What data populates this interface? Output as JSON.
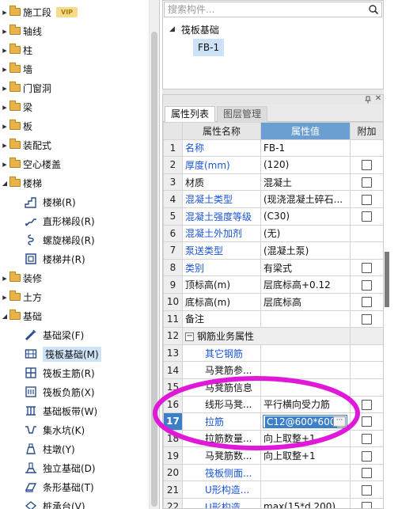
{
  "tree": {
    "top_item": {
      "label": "施工段",
      "badge": "VIP"
    },
    "folders": [
      {
        "label": "轴线",
        "collapsed": true
      },
      {
        "label": "柱",
        "collapsed": true
      },
      {
        "label": "墙",
        "collapsed": true
      },
      {
        "label": "门窗洞",
        "collapsed": true
      },
      {
        "label": "梁",
        "collapsed": true
      },
      {
        "label": "板",
        "collapsed": true
      },
      {
        "label": "装配式",
        "collapsed": true
      },
      {
        "label": "空心楼盖",
        "collapsed": true
      },
      {
        "label": "楼梯",
        "collapsed": false
      },
      {
        "label": "装修",
        "collapsed": true
      },
      {
        "label": "土方",
        "collapsed": true
      },
      {
        "label": "基础",
        "collapsed": false
      }
    ],
    "stair_children": [
      "楼梯(R)",
      "直形梯段(R)",
      "螺旋梯段(R)",
      "楼梯井(R)"
    ],
    "foundation_children": [
      "基础梁(F)",
      "筏板基础(M)",
      "筏板主筋(R)",
      "筏板负筋(X)",
      "基础板带(W)",
      "集水坑(K)",
      "柱墩(Y)",
      "独立基础(D)",
      "条形基础(T)",
      "桩承台(V)"
    ],
    "selected": "筏板基础(M)"
  },
  "component_list": {
    "search_placeholder": "搜索构件...",
    "group": "筏板基础",
    "item": "FB-1"
  },
  "properties": {
    "tabs": [
      "属性列表",
      "图层管理"
    ],
    "active_tab": "属性列表",
    "columns": {
      "name": "属性名称",
      "value": "属性值",
      "extra": "附加"
    },
    "rows": [
      {
        "n": "1",
        "name": "名称",
        "value": "FB-1",
        "checkbox": false
      },
      {
        "n": "2",
        "name": "厚度(mm)",
        "value": "(120)",
        "checkbox": true
      },
      {
        "n": "3",
        "name": "材质",
        "value": "混凝土",
        "checkbox": true
      },
      {
        "n": "4",
        "name": "混凝土类型",
        "value": "(现浇混凝土碎石...",
        "checkbox": true
      },
      {
        "n": "5",
        "name": "混凝土强度等级",
        "value": "(C30)",
        "checkbox": true
      },
      {
        "n": "6",
        "name": "混凝土外加剂",
        "value": "(无)",
        "checkbox": false
      },
      {
        "n": "7",
        "name": "泵送类型",
        "value": "(混凝土泵)",
        "checkbox": false
      },
      {
        "n": "8",
        "name": "类别",
        "value": "有梁式",
        "checkbox": true
      },
      {
        "n": "9",
        "name": "顶标高(m)",
        "value": "层底标高+0.12",
        "checkbox": true
      },
      {
        "n": "10",
        "name": "底标高(m)",
        "value": "层底标高",
        "checkbox": true
      },
      {
        "n": "11",
        "name": "备注",
        "value": "",
        "checkbox": true
      },
      {
        "n": "12",
        "name": "钢筋业务属性",
        "value": "",
        "checkbox": false
      },
      {
        "n": "13",
        "name": "其它钢筋",
        "value": "",
        "checkbox": false
      },
      {
        "n": "14",
        "name": "马凳筋参...",
        "value": "",
        "checkbox": false
      },
      {
        "n": "15",
        "name": "马凳筋信息",
        "value": "",
        "checkbox": false
      },
      {
        "n": "16",
        "name": "线形马凳...",
        "value": "平行横向受力筋",
        "checkbox": true
      },
      {
        "n": "17",
        "name": "拉筋",
        "value": "C12@600*600",
        "checkbox": true
      },
      {
        "n": "18",
        "name": "拉筋数量...",
        "value": "向上取整+1",
        "checkbox": true
      },
      {
        "n": "19",
        "name": "马凳筋数...",
        "value": "向上取整+1",
        "checkbox": true
      },
      {
        "n": "20",
        "name": "筏板侧面...",
        "value": "",
        "checkbox": true
      },
      {
        "n": "21",
        "name": "U形构造...",
        "value": "",
        "checkbox": true
      },
      {
        "n": "22",
        "name": "U形构造...",
        "value": "max(15*d,200)",
        "checkbox": true
      }
    ],
    "current_row": "17"
  },
  "colors": {
    "accent": "#3c7ec8",
    "annotation": "#e019d8",
    "folder": "#e7b34a"
  }
}
